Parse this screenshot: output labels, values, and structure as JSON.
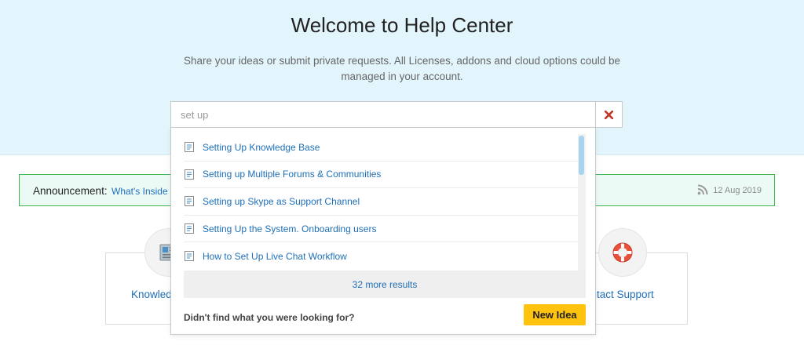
{
  "hero": {
    "title": "Welcome to Help Center",
    "subtitle": "Share your ideas or submit private requests. All Licenses, addons and cloud options could be managed in your account."
  },
  "search": {
    "value": "set up",
    "clear_icon": "close-x-icon",
    "accent_color": "#c0392b"
  },
  "announcement": {
    "label": "Announcement:",
    "link_text": "What's Inside U",
    "date": "12 Aug 2019",
    "icon": "rss-icon",
    "border_color": "#3cb44a"
  },
  "cards": {
    "left_label": "Knowled",
    "right_label": "ontact Support",
    "left_icon": "knowledge-base-icon",
    "right_icon": "lifebuoy-icon"
  },
  "dropdown": {
    "results": [
      {
        "label": "Setting Up Knowledge Base"
      },
      {
        "label": "Setting up Multiple Forums & Communities"
      },
      {
        "label": "Setting up Skype as Support Channel"
      },
      {
        "label": "Setting Up the System. Onboarding users"
      },
      {
        "label": "How to Set Up Live Chat Workflow"
      }
    ],
    "more_results": "32 more results",
    "not_found_text": "Didn't find what you were looking for?",
    "new_idea_label": "New Idea",
    "button_color": "#ffc20e"
  }
}
